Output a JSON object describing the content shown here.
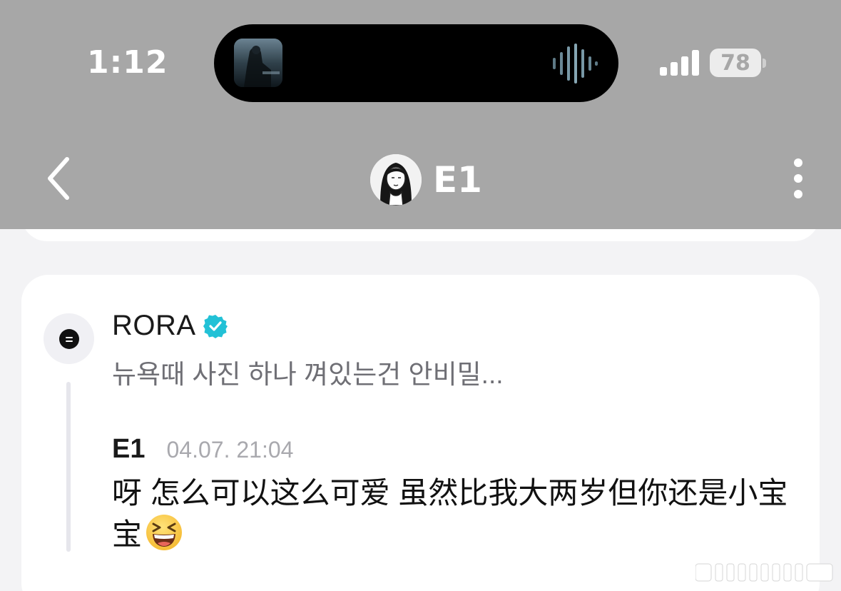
{
  "status_bar": {
    "time": "1:12",
    "battery": "78"
  },
  "header": {
    "title": "E1"
  },
  "comment": {
    "author": "RORA",
    "preview": "뉴욕때 사진 하나 껴있는건 안비밀..."
  },
  "reply": {
    "author": "E1",
    "timestamp": "04.07. 21:04",
    "text": "呀 怎么可以这么可爱 虽然比我大两岁但你还是小宝宝"
  },
  "icons": {
    "back": "chevron-left-icon",
    "more": "more-vertical-icon",
    "verified": "verified-badge-icon",
    "emoji": "grinning-squinting-face-emoji",
    "signal": "cellular-signal-icon",
    "waveform": "audio-waveform-icon"
  },
  "colors": {
    "overlay": "#a7a7a7",
    "verified": "#22c1d6",
    "card": "#ffffff",
    "page_bg": "#f3f3f5"
  }
}
